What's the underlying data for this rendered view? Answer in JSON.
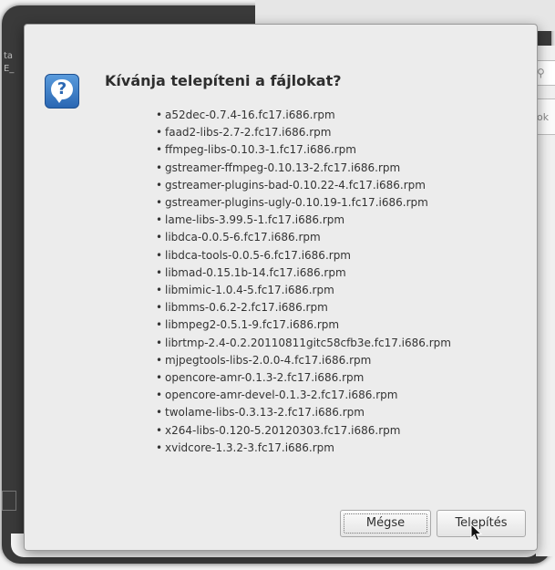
{
  "dialog": {
    "title": "Kívánja telepíteni a fájlokat?",
    "icon": "question-icon",
    "packages": [
      "a52dec-0.7.4-16.fc17.i686.rpm",
      "faad2-libs-2.7-2.fc17.i686.rpm",
      "ffmpeg-libs-0.10.3-1.fc17.i686.rpm",
      "gstreamer-ffmpeg-0.10.13-2.fc17.i686.rpm",
      "gstreamer-plugins-bad-0.10.22-4.fc17.i686.rpm",
      "gstreamer-plugins-ugly-0.10.19-1.fc17.i686.rpm",
      "lame-libs-3.99.5-1.fc17.i686.rpm",
      "libdca-0.0.5-6.fc17.i686.rpm",
      "libdca-tools-0.0.5-6.fc17.i686.rpm",
      "libmad-0.15.1b-14.fc17.i686.rpm",
      "libmimic-1.0.4-5.fc17.i686.rpm",
      "libmms-0.6.2-2.fc17.i686.rpm",
      "libmpeg2-0.5.1-9.fc17.i686.rpm",
      "librtmp-2.4-0.2.20110811gitc58cfb3e.fc17.i686.rpm",
      "mjpegtools-libs-2.0.0-4.fc17.i686.rpm",
      "opencore-amr-0.1.3-2.fc17.i686.rpm",
      "opencore-amr-devel-0.1.3-2.fc17.i686.rpm",
      "twolame-libs-0.3.13-2.fc17.i686.rpm",
      "x264-libs-0.120-5.20120303.fc17.i686.rpm",
      "xvidcore-1.3.2-3.fc17.i686.rpm"
    ],
    "bullet": "•",
    "cancel_label": "Mégse",
    "install_label": "Telepítés"
  },
  "background": {
    "left_text_1": "ta",
    "left_text_2": "E_",
    "right_ok_text": "ok"
  },
  "colors": {
    "dialog_bg": "#ececec",
    "icon_blue": "#2a67b3",
    "text": "#333333"
  }
}
